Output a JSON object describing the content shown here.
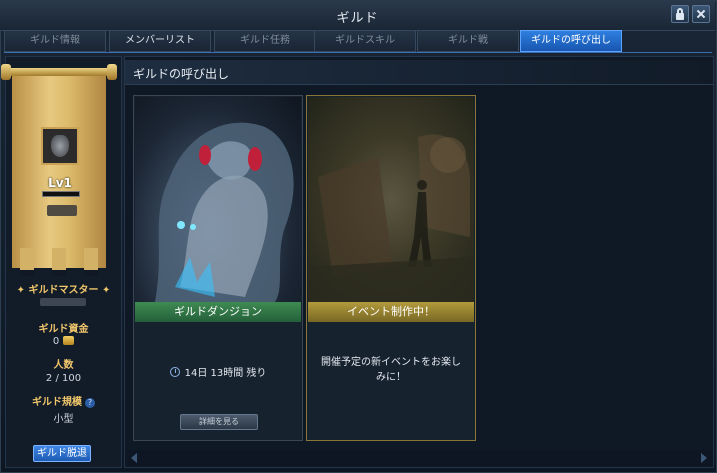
{
  "window": {
    "title": "ギルド"
  },
  "tabs": [
    {
      "label": "ギルド情報"
    },
    {
      "label": "メンバーリスト"
    },
    {
      "label": "ギルド任務"
    },
    {
      "label": "ギルドスキル"
    },
    {
      "label": "ギルド戦"
    },
    {
      "label": "ギルドの呼び出し"
    }
  ],
  "sidebar": {
    "level": "Lv1",
    "master_label": "ギルドマスター",
    "funds_label": "ギルド資金",
    "funds_value": "0",
    "members_label": "人数",
    "members_value": "2 / 100",
    "scale_label": "ギルド規模",
    "scale_help": "?",
    "scale_value": "小型",
    "leave_button": "ギルド脱退"
  },
  "main": {
    "title": "ギルドの呼び出し",
    "cards": [
      {
        "name": "ギルドダンジョン",
        "timer": "14日 13時間 残り",
        "button": "詳細を見る"
      },
      {
        "name": "イベント制作中！",
        "description": "開催予定の新イベントをお楽しみに！"
      }
    ]
  },
  "icons": {
    "lock": "lock-icon",
    "close": "close-icon",
    "clock": "clock-icon",
    "coin": "gold-coin-icon",
    "emblem": "guild-emblem-icon"
  },
  "colors": {
    "accent": "#2f7fe0",
    "gold": "#f0c66b",
    "green": "#3f8a52"
  }
}
